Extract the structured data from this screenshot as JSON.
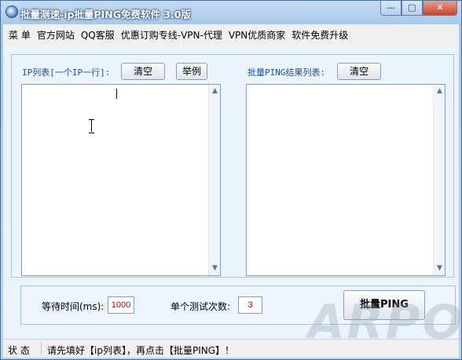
{
  "window": {
    "title": "批量测速-ip批量PING免费软件 3.0版",
    "controls": {
      "minimize": "—",
      "maximize": "□",
      "close": "✕"
    }
  },
  "menu": {
    "items": [
      {
        "label": "菜 单"
      },
      {
        "label": "官方网站"
      },
      {
        "label": "QQ客服"
      },
      {
        "label": "优惠订购专线-VPN-代理"
      },
      {
        "label": "VPN优质商家"
      },
      {
        "label": "软件免费升级"
      }
    ]
  },
  "ip_panel": {
    "label": "IP列表[一个IP一行]:",
    "clear_button": "清空",
    "example_button": "举例",
    "textarea_value": ""
  },
  "result_panel": {
    "label": "批量PING结果列表:",
    "clear_button": "清空",
    "list_value": ""
  },
  "settings": {
    "timeout_label": "等待时间(ms):",
    "timeout_value": "1000",
    "count_label": "单个测试次数:",
    "count_value": "3",
    "ping_button": "批量PING"
  },
  "watermark": "ARPON",
  "status": {
    "label": "状 态",
    "message": "请先填好【ip列表】，再点击【批量PING】！"
  },
  "colors": {
    "title_bar": "#b9d3ee",
    "accent_label": "#1b4fa0",
    "value_text": "#c00000",
    "close_button": "#c7452c"
  }
}
